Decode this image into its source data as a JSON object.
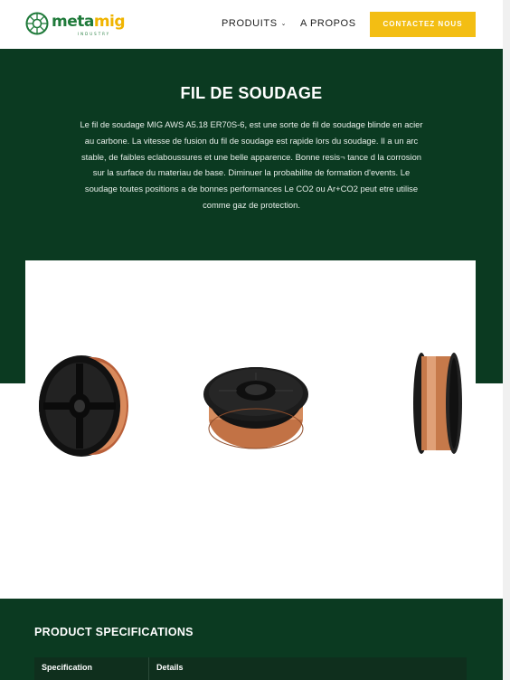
{
  "header": {
    "logo": {
      "brand_part1": "meta",
      "brand_part2": "mig",
      "tagline": "INDUSTRY"
    },
    "nav": [
      {
        "label": "PRODUITS",
        "has_dropdown": true
      },
      {
        "label": "A PROPOS",
        "has_dropdown": false
      }
    ],
    "cta_label": "CONTACTEZ NOUS"
  },
  "hero": {
    "title": "FIL DE SOUDAGE",
    "description": "Le fil de soudage MIG AWS A5.18 ER70S-6, est une sorte de fil de soudage blinde en acier au carbone. La vitesse de fusion du fil de soudage est rapide lors du soudage. Il a un arc stable, de faibles eclaboussures et une belle apparence. Bonne resis¬ tance d la corrosion sur la surface du materiau de base. Diminuer la probabilite de formation d'events. Le soudage toutes positions a de bonnes performances Le CO2 ou Ar+CO2 peut etre utilise comme gaz de protection."
  },
  "products": {
    "images": [
      {
        "name": "spool-black-side-view"
      },
      {
        "name": "spool-copper-top-view"
      },
      {
        "name": "spool-copper-edge-view"
      }
    ]
  },
  "specs": {
    "title": "PRODUCT SPECIFICATIONS",
    "columns": [
      "Specification",
      "Details"
    ]
  },
  "colors": {
    "dark_green": "#0b3a21",
    "accent_yellow": "#f3be13",
    "brand_green": "#1f7a3a",
    "copper": "#c9784a"
  }
}
